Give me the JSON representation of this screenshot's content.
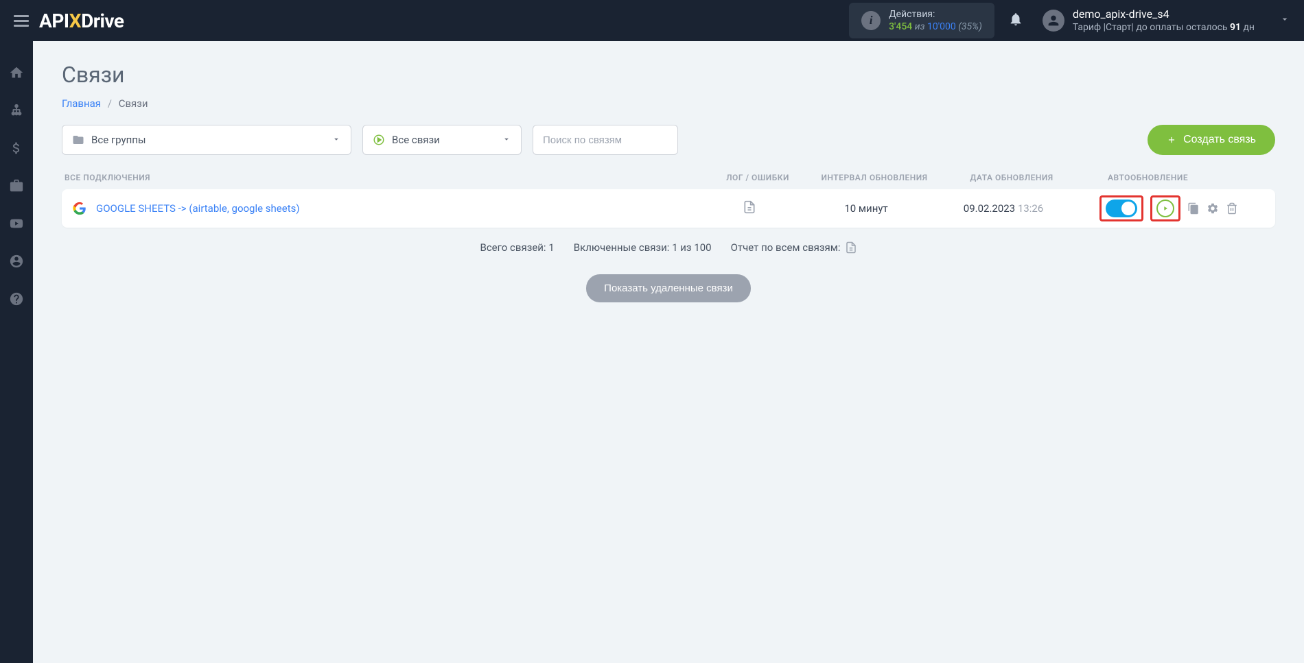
{
  "header": {
    "actions_label": "Действия:",
    "actions_count": "3'454",
    "actions_of": "из",
    "actions_total": "10'000",
    "actions_pct": "(35%)",
    "user_name": "demo_apix-drive_s4",
    "tariff_prefix": "Тариф |Старт| до оплаты осталось ",
    "tariff_days": "91",
    "tariff_suffix": " дн"
  },
  "page": {
    "title": "Связи",
    "breadcrumb_home": "Главная",
    "breadcrumb_current": "Связи"
  },
  "filters": {
    "groups_label": "Все группы",
    "status_label": "Все связи",
    "search_placeholder": "Поиск по связям",
    "create_label": "Создать связь"
  },
  "table": {
    "col_name": "ВСЕ ПОДКЛЮЧЕНИЯ",
    "col_log": "ЛОГ / ОШИБКИ",
    "col_interval": "ИНТЕРВАЛ ОБНОВЛЕНИЯ",
    "col_date": "ДАТА ОБНОВЛЕНИЯ",
    "col_auto": "АВТООБНОВЛЕНИЕ",
    "rows": [
      {
        "name": "GOOGLE SHEETS -> (airtable, google sheets)",
        "interval": "10 минут",
        "date": "09.02.2023",
        "time": "13:26"
      }
    ]
  },
  "summary": {
    "total": "Всего связей: 1",
    "enabled": "Включенные связи: 1 из 100",
    "report": "Отчет по всем связям:",
    "show_deleted": "Показать удаленные связи"
  }
}
